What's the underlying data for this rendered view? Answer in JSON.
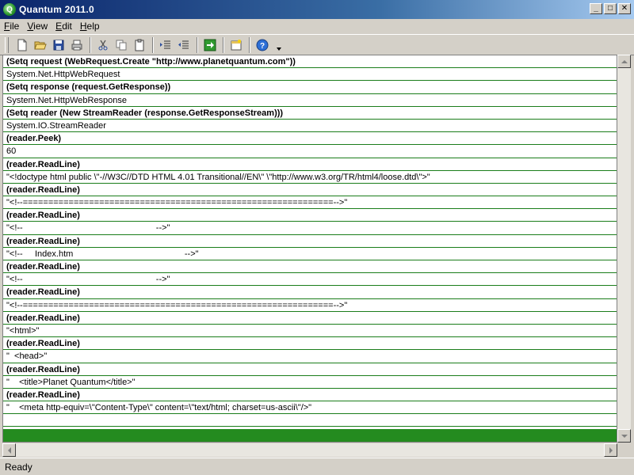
{
  "window": {
    "title": "Quantum 2011.0",
    "minimize_glyph": "_",
    "maximize_glyph": "□",
    "close_glyph": "✕"
  },
  "menu": [
    {
      "label": "File",
      "accel": "F",
      "rest": "ile"
    },
    {
      "label": "View",
      "accel": "V",
      "rest": "iew"
    },
    {
      "label": "Edit",
      "accel": "E",
      "rest": "dit"
    },
    {
      "label": "Help",
      "accel": "H",
      "rest": "elp"
    }
  ],
  "toolbar": {
    "icons": [
      "new-file-icon",
      "open-folder-icon",
      "save-disk-icon",
      "print-icon",
      "cut-scissors-icon",
      "copy-icon",
      "paste-clipboard-icon",
      "indent-icon",
      "outdent-icon",
      "run-arrow-icon",
      "new-window-icon",
      "help-icon"
    ]
  },
  "transcript": [
    {
      "kind": "cmd",
      "text": "(Setq request (WebRequest.Create \"http://www.planetquantum.com\"))"
    },
    {
      "kind": "out",
      "text": "System.Net.HttpWebRequest"
    },
    {
      "kind": "cmd",
      "text": "(Setq response (request.GetResponse))"
    },
    {
      "kind": "out",
      "text": "System.Net.HttpWebResponse"
    },
    {
      "kind": "cmd",
      "text": "(Setq reader (New StreamReader (response.GetResponseStream)))"
    },
    {
      "kind": "out",
      "text": "System.IO.StreamReader"
    },
    {
      "kind": "cmd",
      "text": "(reader.Peek)"
    },
    {
      "kind": "out",
      "text": "60"
    },
    {
      "kind": "cmd",
      "text": "(reader.ReadLine)"
    },
    {
      "kind": "out",
      "text": "\"<!doctype html public \\\"-//W3C//DTD HTML 4.01 Transitional//EN\\\" \\\"http://www.w3.org/TR/html4/loose.dtd\\\">\""
    },
    {
      "kind": "cmd",
      "text": "(reader.ReadLine)"
    },
    {
      "kind": "out",
      "text": "\"<!--=============================================================-->\""
    },
    {
      "kind": "cmd",
      "text": "(reader.ReadLine)"
    },
    {
      "kind": "out",
      "text": "\"<!--                                                       -->\""
    },
    {
      "kind": "cmd",
      "text": "(reader.ReadLine)"
    },
    {
      "kind": "out",
      "text": "\"<!--     Index.htm                                              -->\""
    },
    {
      "kind": "cmd",
      "text": "(reader.ReadLine)"
    },
    {
      "kind": "out",
      "text": "\"<!--                                                       -->\""
    },
    {
      "kind": "cmd",
      "text": "(reader.ReadLine)"
    },
    {
      "kind": "out",
      "text": "\"<!--=============================================================-->\""
    },
    {
      "kind": "cmd",
      "text": "(reader.ReadLine)"
    },
    {
      "kind": "out",
      "text": "\"<html>\""
    },
    {
      "kind": "cmd",
      "text": "(reader.ReadLine)"
    },
    {
      "kind": "out",
      "text": "\"  <head>\""
    },
    {
      "kind": "cmd",
      "text": "(reader.ReadLine)"
    },
    {
      "kind": "out",
      "text": "\"    <title>Planet Quantum</title>\""
    },
    {
      "kind": "cmd",
      "text": "(reader.ReadLine)"
    },
    {
      "kind": "out",
      "text": "\"    <meta http-equiv=\\\"Content-Type\\\" content=\\\"text/html; charset=us-ascii\\\"/>\""
    },
    {
      "kind": "out",
      "text": ""
    }
  ],
  "status": {
    "text": "Ready"
  }
}
